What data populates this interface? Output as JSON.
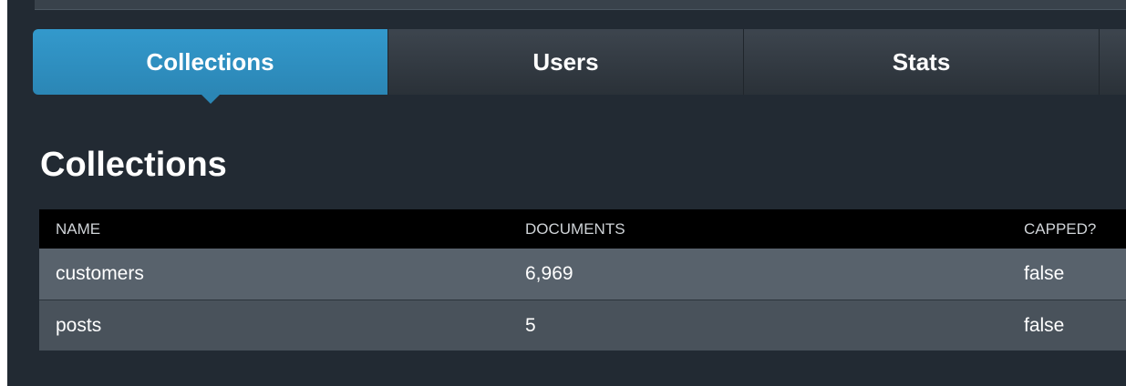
{
  "tabs": [
    {
      "label": "Collections",
      "active": true
    },
    {
      "label": "Users",
      "active": false
    },
    {
      "label": "Stats",
      "active": false
    },
    {
      "label": "",
      "active": false
    }
  ],
  "page": {
    "title": "Collections"
  },
  "table": {
    "columns": [
      "NAME",
      "DOCUMENTS",
      "CAPPED?"
    ],
    "rows": [
      [
        "customers",
        "6,969",
        "false"
      ],
      [
        "posts",
        "5",
        "false"
      ]
    ]
  },
  "colors": {
    "background": "#222a33",
    "accent": "#3399cc",
    "header": "#000000",
    "row_light": "#58626c",
    "row_dark": "#49525b"
  }
}
